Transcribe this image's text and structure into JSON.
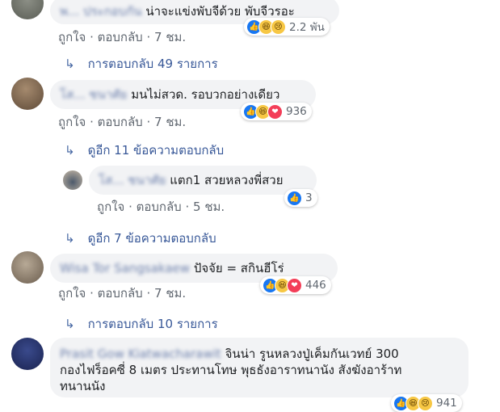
{
  "actions": {
    "like": "ถูกใจ",
    "sep": "·",
    "reply": "ตอบกลับ"
  },
  "comments": [
    {
      "author": "พ... ประกอบกัน",
      "text": "น่าจะแข่งพับจีด้วย พับจีวรอะ",
      "time": "7 ชม.",
      "reaction_count": "2.2 พัน",
      "reactions": [
        "like-icon",
        "haha-icon",
        "sad-icon"
      ]
    },
    {
      "author": "โส... ชนาศัย",
      "text": "มนไม่สวด. รอบวกอย่างเดียว",
      "time": "7 ชม.",
      "reaction_count": "936",
      "reactions": [
        "like-icon",
        "haha-icon",
        "love-icon"
      ]
    },
    {
      "author": "Wisa Tor Sangsakaew",
      "text": "ปัจจัย = สกินฮีโร่",
      "time": "7 ชม.",
      "reaction_count": "446",
      "reactions": [
        "like-icon",
        "haha-icon",
        "love-icon"
      ]
    },
    {
      "author": "Prasit Gow Kiatwacharawit",
      "text_line1": "จินน่า รูนหลวงปู่เค็มกันเวทย์ 300",
      "text_line2": "กองไฟร็อคซี่ 8 เมตร ประทานโทษ พุธธังอาราทนานัง สังฆังอาร้าท",
      "text_line3": "ทนานนัง",
      "reaction_count": "941",
      "reactions": [
        "like-icon",
        "haha-icon",
        "sad-icon"
      ]
    }
  ],
  "replies_49": "การตอบกลับ 49 รายการ",
  "view_11": "ดูอีก 11 ข้อความตอบกลับ",
  "reply": {
    "author": "โส... ชนาศัย",
    "text": "แตก1 สวยหลวงพี่สวย",
    "time": "5 ชม.",
    "reaction_count": "3"
  },
  "view_7": "ดูอีก 7 ข้อความตอบกลับ",
  "replies_10": "การตอบกลับ 10 รายการ",
  "colors": {
    "link": "#385898",
    "bubble": "#f2f3f5",
    "meta": "#606770"
  }
}
